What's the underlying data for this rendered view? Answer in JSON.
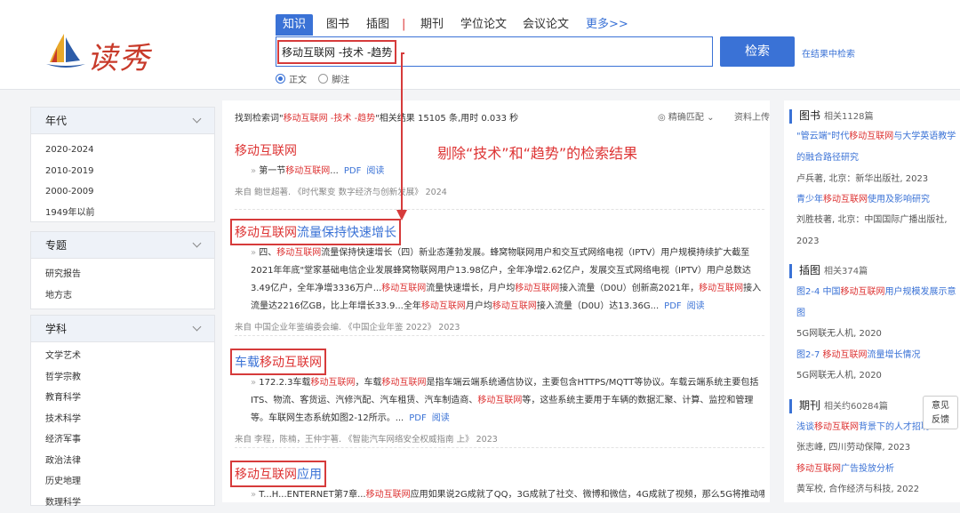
{
  "brand": {
    "name": "读秀"
  },
  "nav": {
    "tabs": [
      "知识",
      "图书",
      "插图",
      "期刊",
      "学位论文",
      "会议论文"
    ],
    "separator": "|",
    "more": "更多>>"
  },
  "search": {
    "query": "移动互联网 -技术 -趋势",
    "button": "检索",
    "within": "在结果中检索"
  },
  "radios": [
    {
      "label": "正文",
      "checked": true
    },
    {
      "label": "脚注",
      "checked": false
    }
  ],
  "sidebar": [
    {
      "title": "年代",
      "items": [
        "2020-2024",
        "2010-2019",
        "2000-2009",
        "1949年以前"
      ]
    },
    {
      "title": "专题",
      "items": [
        "研究报告",
        "地方志"
      ]
    },
    {
      "title": "学科",
      "items": [
        "文学艺术",
        "哲学宗教",
        "教育科学",
        "技术科学",
        "经济军事",
        "政治法律",
        "历史地理",
        "数理科学"
      ]
    }
  ],
  "summary": {
    "pre": "找到检索词\"",
    "term": "移动互联网 -技术 -趋势",
    "post": "\"相关结果 15105 条,用时 0.033 秒"
  },
  "sort": "精确匹配",
  "upload": "资料上传",
  "annotation": "剔除“技术”和“趋势”的检索结果",
  "results": [
    {
      "title_hl": "移动互联网",
      "title_rest": "",
      "snippet_pre": "第一节",
      "snippet_hl": "移动互联网",
      "snippet_post": "...",
      "pdf": "PDF",
      "read": "阅读",
      "source": "来自 鲍世超著. 《时代聚变 数字经济与创新发展》 2024"
    },
    {
      "title_hl": "移动互联网",
      "title_rest": "流量保持快速增长",
      "snippet": [
        "四、",
        "移动互联网",
        "流量保持快速增长（四）新业态蓬勃发展。蜂窝物联网用户和交互式网络电视（IPTV）用户规模持续扩大截至2021年年底\"堂家基础电信企业发展蜂窝物联网用户13.98亿户，全年净增2.62亿户，发展交互式网络电视（IPTV）用户总数达3.49亿户，全年净增3336万户...",
        "移动互联网",
        "流量快速增长，月户均",
        "移动互联网",
        "接入流量（D0U）创新高2021年，",
        "移动互联网",
        "接入流量达2216亿GB，比上年增长33.9...全年",
        "移动互联网",
        "月户均",
        "移动互联网",
        "接入流量（D0U）达13.36G..."
      ],
      "pdf": "PDF",
      "read": "阅读",
      "source": "来自 中国企业年鉴编委会编. 《中国企业年鉴 2022》 2023"
    },
    {
      "title_pre": "车载",
      "title_hl": "移动互联网",
      "snippet": [
        "172.2.3车载",
        "移动互联网",
        "，车载",
        "移动互联网",
        "是指车端云端系统通信协议，主要包含HTTPS/MQTT等协议。车载云端系统主要包括ITS、物流、客货运、汽修汽配、汽车租赁、汽车制造商、",
        "移动互联网",
        "等，这些系统主要用于车辆的数据汇聚、计算、监控和管理等。车联网生态系统如图2-12所示。..."
      ],
      "pdf": "PDF",
      "read": "阅读",
      "source": "来自 李程，陈楠，王仲宇著. 《智能汽车网络安全权威指南 上》 2023"
    },
    {
      "title_hl": "移动互联网",
      "title_rest": "应用",
      "snippet": [
        "T...H...ENTERNET第7章...",
        "移动互联网",
        "应用如果说2G成就了QQ，3G成就了社交、微博和微信，4G成就了视频，那么5G将推动哪"
      ]
    }
  ],
  "right": {
    "books": {
      "title": "图书",
      "count": "相关1128篇",
      "items": [
        {
          "title": [
            "\"管云端\"时代",
            "移动互联网",
            "与大学英语教学的融合路径研究"
          ],
          "meta": "卢兵著, 北京：新华出版社, 2023"
        },
        {
          "title": [
            "青少年",
            "移动互联网",
            "使用及影响研究"
          ],
          "meta": "刘胜枝著, 北京：中国国际广播出版社, 2023"
        }
      ]
    },
    "figures": {
      "title": "插图",
      "count": "相关374篇",
      "items": [
        {
          "title": [
            "图2-4 中国",
            "移动互联网",
            "用户规模发展示意图"
          ],
          "meta": "5G网联无人机, 2020"
        },
        {
          "title": [
            "图2-7 ",
            "移动互联网",
            "流量增长情况"
          ],
          "meta": "5G网联无人机, 2020"
        }
      ]
    },
    "journals": {
      "title": "期刊",
      "count": "相关约60284篇",
      "items": [
        {
          "title": [
            "浅谈",
            "移动互联网",
            "背景下的人才招聘"
          ],
          "meta": "张志峰, 四川劳动保障, 2023"
        },
        {
          "title": [
            "",
            "移动互联网",
            "广告投放分析"
          ],
          "meta": "黄军校, 合作经济与科技, 2022"
        }
      ]
    }
  },
  "feedback": [
    "意见",
    "反馈"
  ],
  "colors": {
    "accent": "#3a72d6",
    "highlight": "#dd3333",
    "annotation_box": "#d63b3b"
  }
}
